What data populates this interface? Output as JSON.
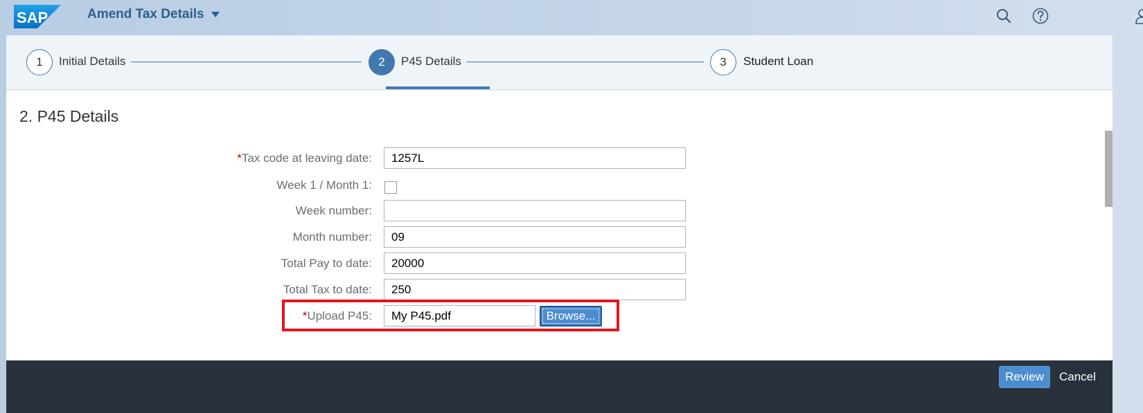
{
  "shell": {
    "logo_text": "SAP",
    "app_title": "Amend Tax Details",
    "icons": [
      "search-icon",
      "help-icon",
      "user-icon"
    ]
  },
  "wizard": {
    "steps": [
      {
        "number": "1",
        "label": "Initial Details",
        "state": "done"
      },
      {
        "number": "2",
        "label": "P45 Details",
        "state": "active"
      },
      {
        "number": "3",
        "label": "Student Loan",
        "state": "upcoming"
      }
    ]
  },
  "form": {
    "section_title": "2. P45 Details",
    "fields": {
      "tax_code": {
        "required_mark": "*",
        "label": "Tax code at leaving date:",
        "value": "1257L"
      },
      "week1_month1": {
        "label": "Week 1 / Month 1:",
        "checked": false
      },
      "week_number": {
        "label": "Week number:",
        "value": ""
      },
      "month_number": {
        "label": "Month number:",
        "value": "09"
      },
      "total_pay": {
        "label": "Total Pay to date:",
        "value": "20000"
      },
      "total_tax": {
        "label": "Total Tax to date:",
        "value": "250"
      },
      "upload_p45": {
        "required_mark": "*",
        "label": "Upload P45:",
        "value": "My P45.pdf",
        "browse_label": "Browse..."
      }
    }
  },
  "footer": {
    "review_label": "Review",
    "cancel_label": "Cancel"
  },
  "colors": {
    "accent": "#3f79ad",
    "button": "#4c8dcf",
    "footer_bg": "#29323c",
    "required": "#bb0000",
    "highlight": "#e4151f"
  }
}
